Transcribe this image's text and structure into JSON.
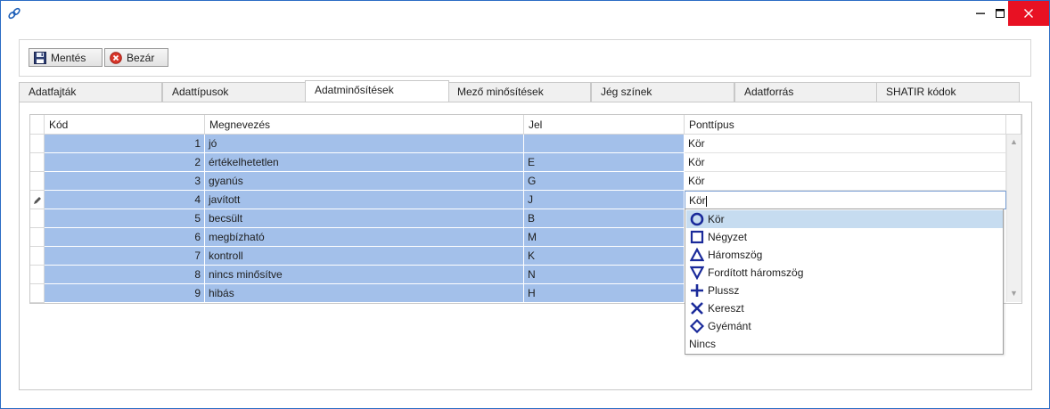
{
  "window": {
    "minimize": "—",
    "maximize": "☐",
    "close": "✕"
  },
  "toolbar": {
    "save_label": "Mentés",
    "close_label": "Bezár"
  },
  "tabs": [
    {
      "label": "Adatfajták"
    },
    {
      "label": "Adattípusok"
    },
    {
      "label": "Adatminősítések",
      "active": true
    },
    {
      "label": "Mező minősítések"
    },
    {
      "label": "Jég színek"
    },
    {
      "label": "Adatforrás"
    },
    {
      "label": "SHATIR kódok"
    }
  ],
  "grid": {
    "columns": {
      "kod": "Kód",
      "megnevezes": "Megnevezés",
      "jel": "Jel",
      "ponttipus": "Ponttípus"
    },
    "rows": [
      {
        "kod": "1",
        "megnevezes": "jó",
        "jel": "",
        "ponttipus": "Kör"
      },
      {
        "kod": "2",
        "megnevezes": "értékelhetetlen",
        "jel": "E",
        "ponttipus": "Kör"
      },
      {
        "kod": "3",
        "megnevezes": "gyanús",
        "jel": "G",
        "ponttipus": "Kör"
      },
      {
        "kod": "4",
        "megnevezes": "javított",
        "jel": "J",
        "ponttipus": "Kör"
      },
      {
        "kod": "5",
        "megnevezes": "becsült",
        "jel": "B",
        "ponttipus": ""
      },
      {
        "kod": "6",
        "megnevezes": "megbízható",
        "jel": "M",
        "ponttipus": ""
      },
      {
        "kod": "7",
        "megnevezes": "kontroll",
        "jel": "K",
        "ponttipus": ""
      },
      {
        "kod": "8",
        "megnevezes": "nincs minősítve",
        "jel": "N",
        "ponttipus": ""
      },
      {
        "kod": "9",
        "megnevezes": "hibás",
        "jel": "H",
        "ponttipus": ""
      }
    ],
    "editing_row": 3,
    "editing_icon": "pencil-icon"
  },
  "dropdown": {
    "selected": "Kör",
    "options": [
      {
        "label": "Kör",
        "icon": "circle-icon"
      },
      {
        "label": "Négyzet",
        "icon": "square-icon"
      },
      {
        "label": "Háromszög",
        "icon": "triangle-icon"
      },
      {
        "label": "Fordított háromszög",
        "icon": "inverted-triangle-icon"
      },
      {
        "label": "Plussz",
        "icon": "plus-icon"
      },
      {
        "label": "Kereszt",
        "icon": "cross-icon"
      },
      {
        "label": "Gyémánt",
        "icon": "diamond-icon"
      },
      {
        "label": "Nincs",
        "icon": ""
      }
    ]
  },
  "colors": {
    "selection": "#a3c0ea",
    "highlight": "#c6dcf0",
    "accent": "#1a2a9a",
    "close": "#e81123"
  }
}
